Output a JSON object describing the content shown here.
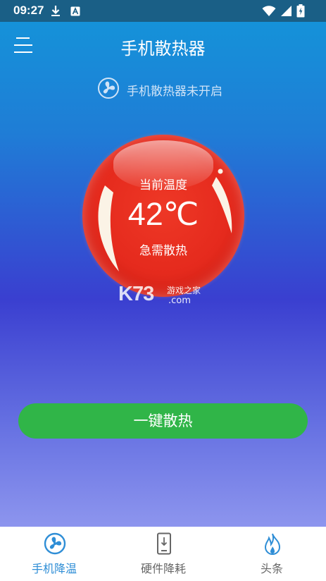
{
  "status_bar": {
    "time": "09:27",
    "icons": [
      "download-icon",
      "a-icon",
      "wifi-icon",
      "signal-icon",
      "battery-icon"
    ]
  },
  "header": {
    "title": "手机散热器",
    "menu_icon": "menu-icon"
  },
  "fan_status": {
    "text": "手机散热器未开启",
    "icon": "fan-icon"
  },
  "temperature": {
    "label": "当前温度",
    "value": "42℃",
    "state": "急需散热"
  },
  "watermark": {
    "logo": "K73",
    "tagline": "游戏之家",
    "domain": ".com"
  },
  "cool_button": {
    "label": "一键散热"
  },
  "tabs": [
    {
      "label": "手机降温",
      "icon": "fan-icon",
      "active": true
    },
    {
      "label": "硬件降耗",
      "icon": "phone-icon",
      "active": false
    },
    {
      "label": "头条",
      "icon": "flame-icon",
      "active": false
    }
  ],
  "colors": {
    "status_bar": "#1a5f86",
    "gradient_top": "#1592d9",
    "gradient_mid": "#3a3fd0",
    "gradient_bottom": "#8d95ee",
    "ball_red": "#e52a1d",
    "button_green": "#30b548",
    "tab_active": "#2f8ed6",
    "tab_inactive": "#666666"
  }
}
